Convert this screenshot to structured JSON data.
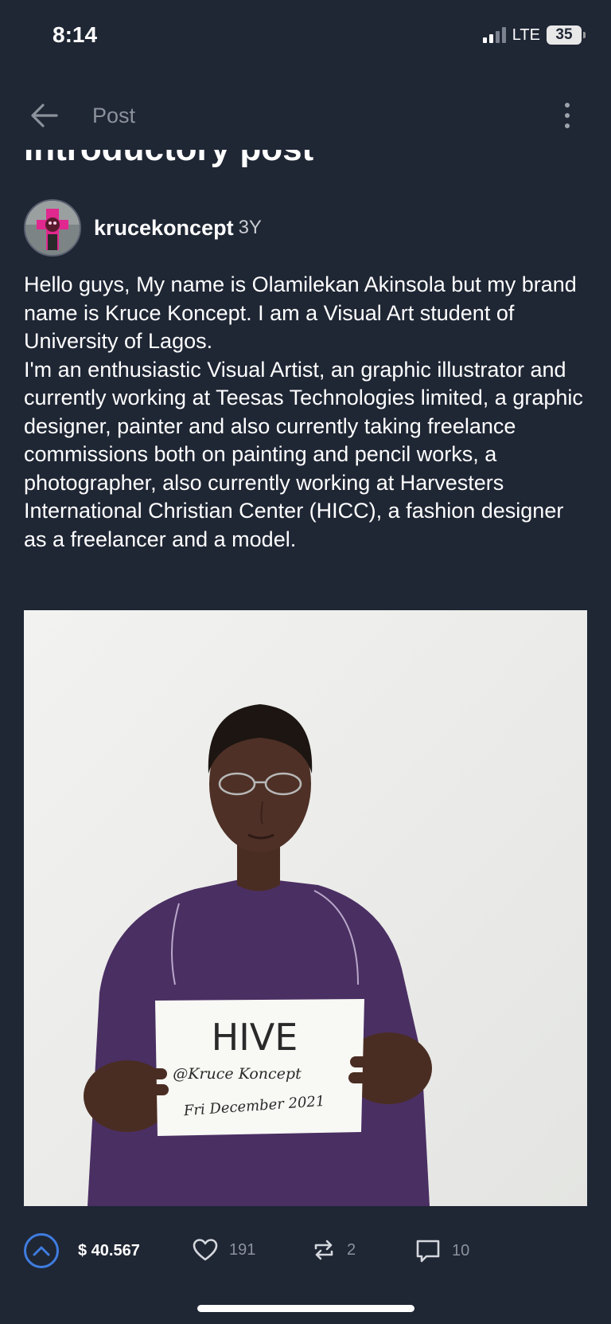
{
  "status_bar": {
    "time": "8:14",
    "network": "LTE",
    "battery": "35"
  },
  "topbar": {
    "back_icon": "arrow-left-icon",
    "title": "Post",
    "more_icon": "more-vertical-icon"
  },
  "post": {
    "title": "Introductory post",
    "author": "krucekoncept",
    "age": "3Y",
    "body": [
      "Hello guys, My name is Olamilekan Akinsola but my brand name is Kruce Koncept. I am a Visual Art student of University of Lagos.",
      "I'm an enthusiastic Visual Artist, an graphic illustrator and currently working at Teesas Technologies limited, a graphic designer, painter and also currently taking freelance commissions both on painting and pencil works, a photographer, also currently working at Harvesters International Christian Center (HICC), a fashion designer as a freelancer and a model."
    ],
    "image_sign": {
      "line1": "HIVE",
      "line2": "@Kruce Koncept",
      "line3": "Fri December 2021"
    }
  },
  "actions": {
    "upvote_icon": "chevron-up-icon",
    "payout": "$ 40.567",
    "likes": "191",
    "reblogs": "2",
    "comments": "10"
  },
  "colors": {
    "background": "#1f2634",
    "accent": "#3f7de0",
    "muted": "#8c929c"
  }
}
